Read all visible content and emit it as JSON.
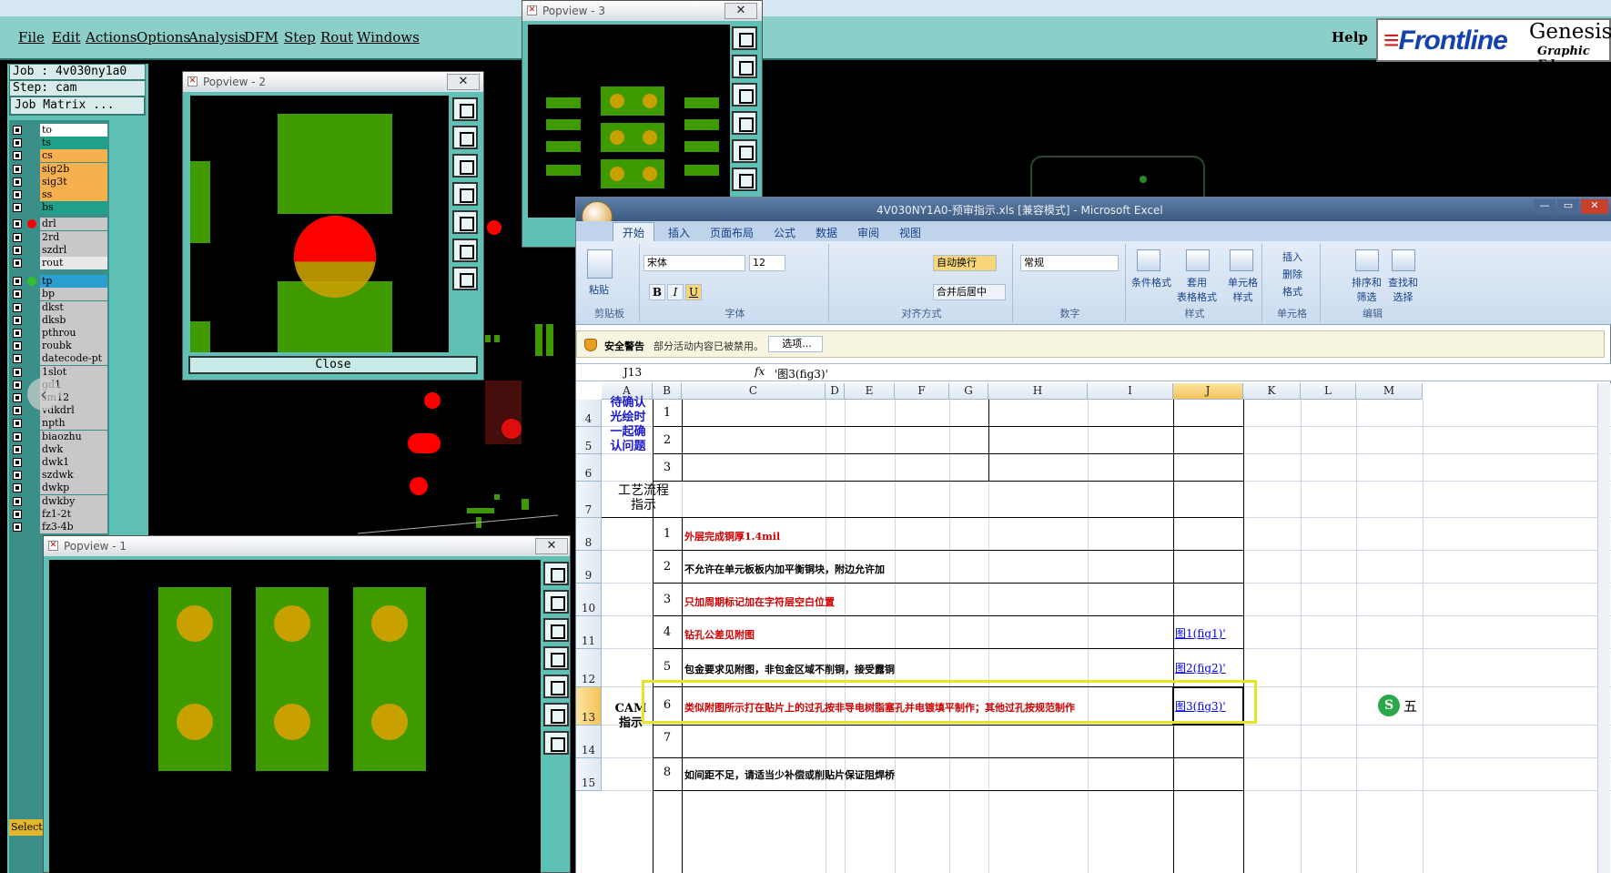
{
  "genesis": {
    "menu": [
      "File",
      "Edit",
      "Actions",
      "Options",
      "Analysis",
      "DFM",
      "Step",
      "Rout",
      "Windows"
    ],
    "help": "Help",
    "logo": {
      "frontline": "Frontline",
      "genesis": "Genesis",
      "graphic": "Graphic Ed"
    },
    "job_label": "Job : 4v030ny1a0",
    "step_label": "Step: cam",
    "job_matrix": "Job Matrix ...",
    "select_label": "Select",
    "layers": [
      {
        "name": "to",
        "color": "#ffffff"
      },
      {
        "name": "ts",
        "color": "#1fa08a"
      },
      {
        "name": "cs",
        "color": "#f6b050"
      },
      {
        "name": "sig2b",
        "color": "#f6b050"
      },
      {
        "name": "sig3t",
        "color": "#f6b050"
      },
      {
        "name": "ss",
        "color": "#f6b050"
      },
      {
        "name": "bs",
        "color": "#1fa08a"
      },
      {
        "name": "drl",
        "color": "#c8c8c8",
        "dot": "#ff0000"
      },
      {
        "name": "2rd",
        "color": "#c8c8c8"
      },
      {
        "name": "szdrl",
        "color": "#c8c8c8"
      },
      {
        "name": "rout",
        "color": "#e8e8e8"
      },
      {
        "name": "tp",
        "color": "#2a9fd0",
        "dot": "#30c030"
      },
      {
        "name": "bp",
        "color": "#c8c8c8"
      },
      {
        "name": "dkst",
        "color": "#c8c8c8"
      },
      {
        "name": "dksb",
        "color": "#c8c8c8"
      },
      {
        "name": "pthrou",
        "color": "#c8c8c8"
      },
      {
        "name": "roubk",
        "color": "#c8c8c8"
      },
      {
        "name": "datecode-pt",
        "color": "#c8c8c8"
      },
      {
        "name": "1slot",
        "color": "#c8c8c8"
      },
      {
        "name": "gd1",
        "color": "#c8c8c8"
      },
      {
        "name": "sm12",
        "color": "#c8c8c8"
      },
      {
        "name": "vdkdrl",
        "color": "#c8c8c8"
      },
      {
        "name": "npth",
        "color": "#c8c8c8"
      },
      {
        "name": "biaozhu",
        "color": "#c8c8c8"
      },
      {
        "name": "dwk",
        "color": "#c8c8c8"
      },
      {
        "name": "dwk1",
        "color": "#c8c8c8"
      },
      {
        "name": "szdwk",
        "color": "#c8c8c8"
      },
      {
        "name": "dwkp",
        "color": "#c8c8c8"
      },
      {
        "name": "dwkby",
        "color": "#c8c8c8"
      },
      {
        "name": "fz1-2t",
        "color": "#c8c8c8"
      },
      {
        "name": "fz3-4b",
        "color": "#c8c8c8"
      }
    ],
    "popview1": "Popview - 1",
    "popview2": "Popview - 2",
    "popview3": "Popview - 3",
    "close_label": "Close",
    "close_x": "✕"
  },
  "excel": {
    "title": "4V030NY1A0-预审指示.xls  [兼容模式] - Microsoft Excel",
    "tabs": [
      "开始",
      "插入",
      "页面布局",
      "公式",
      "数据",
      "审阅",
      "视图"
    ],
    "ribbon": {
      "paste": "粘贴",
      "clipboard": "剪贴板",
      "font_name": "宋体",
      "font_size": "12",
      "font_group": "字体",
      "wrap": "自动换行",
      "merge": "合并后居中",
      "align_group": "对齐方式",
      "number_format": "常规",
      "number_group": "数字",
      "cond_format": "条件格式",
      "table_format": "套用\n表格格式",
      "cell_style": "单元格\n样式",
      "style_group": "样式",
      "insert": "插入",
      "delete": "删除",
      "format": "格式",
      "cells_group": "单元格",
      "sort": "排序和\n筛选",
      "find": "查找和\n选择",
      "edit_group": "编辑",
      "bold": "B",
      "italic": "I",
      "underline": "U"
    },
    "security": {
      "label": "安全警告",
      "message": "部分活动内容已被禁用。",
      "button": "选项..."
    },
    "name_box": "J13",
    "formula": "'图3(fig3)'",
    "columns": [
      "A",
      "B",
      "C",
      "D",
      "E",
      "F",
      "G",
      "H",
      "I",
      "J",
      "K",
      "L",
      "M"
    ],
    "rows": [
      {
        "num": "4"
      },
      {
        "num": "5"
      },
      {
        "num": "6"
      },
      {
        "num": "7"
      },
      {
        "num": "8"
      },
      {
        "num": "9"
      },
      {
        "num": "10"
      },
      {
        "num": "11"
      },
      {
        "num": "12"
      },
      {
        "num": "13"
      },
      {
        "num": "14"
      },
      {
        "num": "15"
      }
    ],
    "section_pending": "待确认\n光绘时\n一起确\n认问题",
    "section_process": "工艺流程\n指示",
    "section_cam": "CAM\n指示",
    "pending_nums": [
      "1",
      "2",
      "3"
    ],
    "steps": [
      {
        "num": "1",
        "text": "外层完成铜厚1.4mil",
        "red": true,
        "link": ""
      },
      {
        "num": "2",
        "text": "不允许在单元板板内加平衡铜块，附边允许加",
        "red": false,
        "link": ""
      },
      {
        "num": "3",
        "text": "只加周期标记加在字符层空白位置",
        "red": true,
        "link": ""
      },
      {
        "num": "4",
        "text": "钻孔公差见附图",
        "red": true,
        "link": "图1(fig1)'"
      },
      {
        "num": "5",
        "text": "包金要求见附图，非包金区域不削铜，接受露铜",
        "red": false,
        "link": "图2(fig2)'"
      },
      {
        "num": "6",
        "text": "类似附图所示打在贴片上的过孔按非导电树脂塞孔并电镀填平制作；其他过孔按规范制作",
        "red": true,
        "link": "图3(fig3)'"
      },
      {
        "num": "7",
        "text": "",
        "red": false,
        "link": ""
      },
      {
        "num": "8",
        "text": "如间距不足，请适当少补偿或削贴片保证阻焊桥",
        "red": false,
        "link": ""
      }
    ],
    "ime_label": "五"
  }
}
